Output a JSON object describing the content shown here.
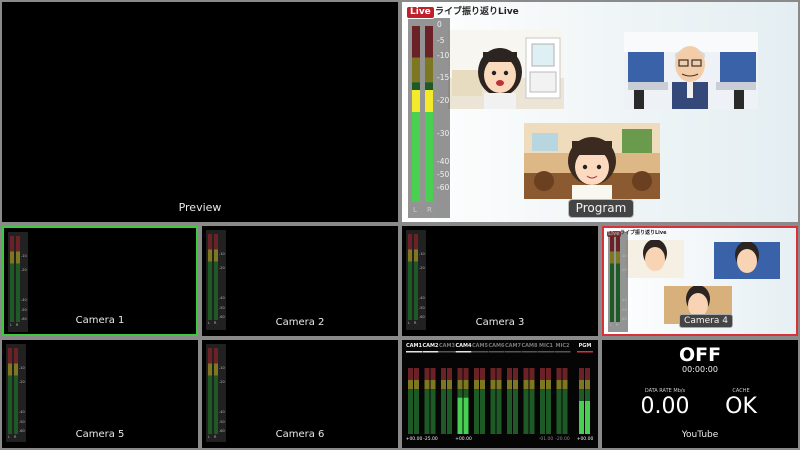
{
  "preview": {
    "label": "Preview"
  },
  "program": {
    "label": "Program",
    "live_badge": "Live",
    "title": "ライブ振り返りLive",
    "meter": {
      "scale": [
        "0",
        "-5",
        "-10",
        "-15",
        "-20",
        "-30",
        "-40",
        "-50",
        "-60"
      ],
      "channels": [
        "L",
        "R"
      ],
      "level": 0.27
    }
  },
  "cameras": [
    {
      "label": "Camera 1",
      "selected": true
    },
    {
      "label": "Camera 2",
      "selected": false
    },
    {
      "label": "Camera 3",
      "selected": false
    },
    {
      "label": "Camera 4",
      "selected": false,
      "live": true
    },
    {
      "label": "Camera 5",
      "selected": false
    },
    {
      "label": "Camera 6",
      "selected": false
    }
  ],
  "mini_meter_scale": [
    "-10",
    "-20",
    "-40",
    "-50",
    "-60"
  ],
  "mini_meter_channels": [
    "L",
    "R"
  ],
  "mixer": {
    "channels": [
      {
        "name": "CAM1",
        "active": true,
        "gain": "+00.00",
        "level": 0
      },
      {
        "name": "CAM2",
        "active": true,
        "gain": "-25.00",
        "level": 0
      },
      {
        "name": "CAM3",
        "active": false,
        "gain": "",
        "level": 0
      },
      {
        "name": "CAM4",
        "active": true,
        "gain": "+00.00",
        "level": 0.55
      },
      {
        "name": "CAM5",
        "active": false,
        "gain": "",
        "level": 0
      },
      {
        "name": "CAM6",
        "active": false,
        "gain": "",
        "level": 0
      },
      {
        "name": "CAM7",
        "active": false,
        "gain": "",
        "level": 0
      },
      {
        "name": "CAM8",
        "active": false,
        "gain": "",
        "level": 0
      },
      {
        "name": "MIC1",
        "active": false,
        "gain": "-01.00",
        "level": 0
      },
      {
        "name": "MIC2",
        "active": false,
        "gain": "-20.00",
        "level": 0
      },
      {
        "name": "PGM",
        "active": true,
        "gain": "+00.00",
        "level": 0.5,
        "highlight": true
      }
    ]
  },
  "stream": {
    "status": "OFF",
    "time": "00:00:00",
    "data_rate_title": "DATA RATE Mb/s",
    "data_rate": "0.00",
    "cache_title": "CACHE",
    "cache": "OK",
    "service": "YouTube"
  },
  "colors": {
    "selected_border": "#3ec93e",
    "live_border": "#d9303a",
    "meter_red": "#6a2226",
    "meter_yellow": "#7c7720",
    "meter_green": "#1e5a26",
    "meter_yellow_lit": "#f2ea2a",
    "meter_green_lit": "#48d050"
  }
}
